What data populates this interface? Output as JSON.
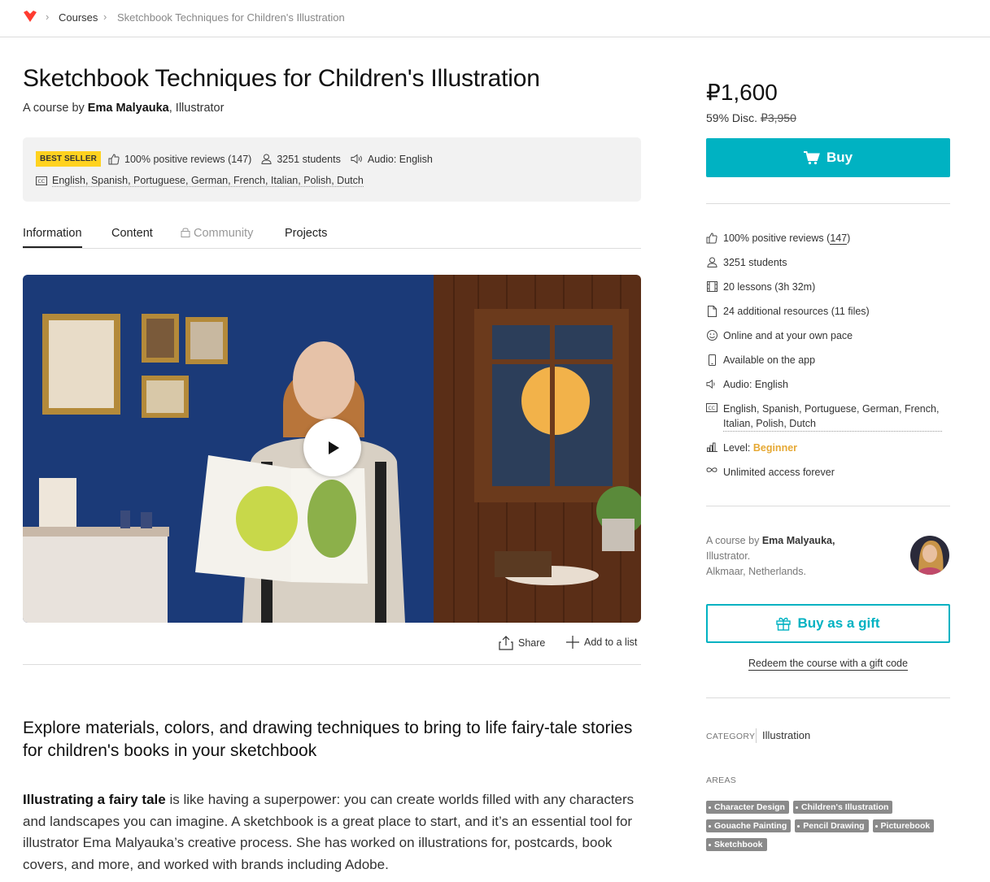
{
  "breadcrumb": {
    "items": [
      "Courses",
      "Sketchbook Techniques for Children's Illustration"
    ]
  },
  "course": {
    "title": "Sketchbook Techniques for Children's Illustration",
    "byline_prefix": "A course by",
    "author": "Ema Malyauka",
    "author_role": ", Illustrator"
  },
  "stats": {
    "badge": "Best seller",
    "reviews": "100% positive reviews (147)",
    "students": "3251 students",
    "audio": "Audio: English",
    "subtitles": "English, Spanish, Portuguese, German, French, Italian, Polish, Dutch"
  },
  "tabs": [
    {
      "label": "Information"
    },
    {
      "label": "Content"
    },
    {
      "label": "Community"
    },
    {
      "label": "Projects"
    }
  ],
  "actions": {
    "share": "Share",
    "add_list": "Add to a list"
  },
  "content": {
    "headline": "Explore materials, colors, and drawing techniques to bring to life fairy-tale stories for children's books in your sketchbook",
    "body_bold": "Illustrating a fairy tale",
    "body_rest": " is like having a superpower: you can create worlds filled with any characters and landscapes you can imagine. A sketchbook is a great place to start, and it’s an essential tool for illustrator Ema Malyauka’s creative process. She has worked on illustrations for, postcards, book covers, and more, and worked with brands including Adobe."
  },
  "purchase": {
    "price": "₽1,600",
    "discount": "59% Disc.",
    "original_price": "₽3,950",
    "buy_label": "Buy"
  },
  "features": {
    "reviews_prefix": "100% positive reviews (",
    "reviews_count": "147",
    "reviews_suffix": ")",
    "students": "3251 students",
    "lessons": "20 lessons (3h 32m)",
    "resources": "24 additional resources (11 files)",
    "pace": "Online and at your own pace",
    "app": "Available on the app",
    "audio": "Audio: English",
    "subtitles": "English, Spanish, Portuguese, German, French, Italian, Polish, Dutch",
    "level_prefix": "Level:",
    "level": "Beginner",
    "access": "Unlimited access forever"
  },
  "author_card": {
    "prefix": "A course by",
    "name": "Ema Malyauka,",
    "role": "Illustrator.",
    "location": "Alkmaar, Netherlands."
  },
  "gift": {
    "button": "Buy as a gift",
    "redeem": "Redeem the course with a gift code"
  },
  "category": {
    "label": "Category",
    "value": "Illustration"
  },
  "areas": {
    "label": "Areas",
    "tags": [
      "Character Design",
      "Children's Illustration",
      "Gouache Painting",
      "Pencil Drawing",
      "Picturebook",
      "Sketchbook"
    ]
  },
  "colors": {
    "accent": "#00b2c2",
    "badge": "#ffd21f",
    "level": "#e6a833",
    "logo": "#ff3b30"
  }
}
